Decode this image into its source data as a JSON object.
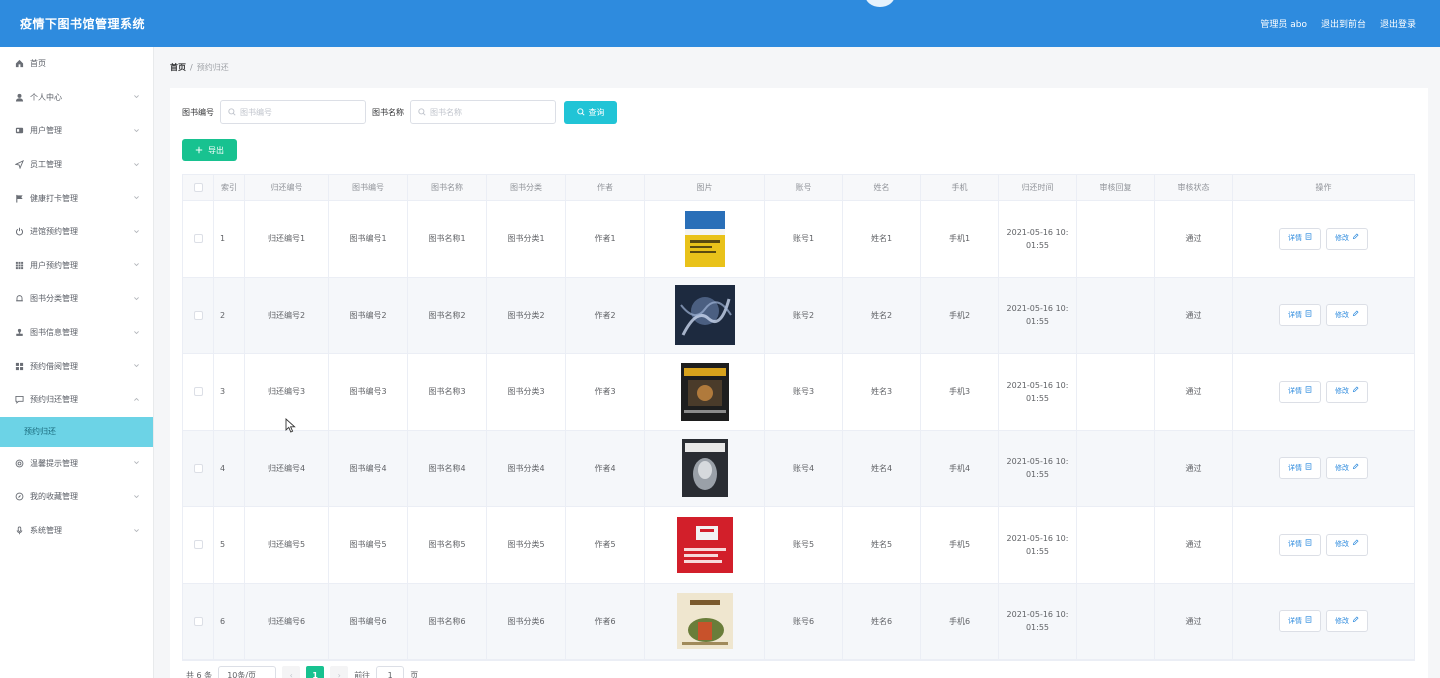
{
  "header": {
    "title": "疫情下图书馆管理系统",
    "user": "管理员 abo",
    "to_front": "退出到前台",
    "logout": "退出登录"
  },
  "sidebar": {
    "items": [
      {
        "label": "首页",
        "icon": "home-icon",
        "chevron": false
      },
      {
        "label": "个人中心",
        "icon": "user-icon",
        "chevron": true
      },
      {
        "label": "用户管理",
        "icon": "id-card-icon",
        "chevron": true
      },
      {
        "label": "员工管理",
        "icon": "send-icon",
        "chevron": true
      },
      {
        "label": "健康打卡管理",
        "icon": "flag-icon",
        "chevron": true
      },
      {
        "label": "进馆预约管理",
        "icon": "power-icon",
        "chevron": true
      },
      {
        "label": "用户预约管理",
        "icon": "grid-icon",
        "chevron": true
      },
      {
        "label": "图书分类管理",
        "icon": "bell-icon",
        "chevron": true
      },
      {
        "label": "图书信息管理",
        "icon": "stamp-icon",
        "chevron": true
      },
      {
        "label": "预约借阅管理",
        "icon": "apps-icon",
        "chevron": true
      },
      {
        "label": "预约归还管理",
        "icon": "message-icon",
        "chevron": true,
        "expanded": true
      }
    ],
    "active_sub": "预约归还",
    "items_after": [
      {
        "label": "温馨提示管理",
        "icon": "help-icon",
        "chevron": true
      },
      {
        "label": "我的收藏管理",
        "icon": "compass-icon",
        "chevron": true
      },
      {
        "label": "系统管理",
        "icon": "mic-icon",
        "chevron": true
      }
    ]
  },
  "breadcrumb": {
    "home": "首页",
    "sep": "/",
    "current": "预约归还"
  },
  "filters": {
    "book_no_label": "图书编号",
    "book_no_placeholder": "图书编号",
    "book_name_label": "图书名称",
    "book_name_placeholder": "图书名称",
    "query_label": "查询",
    "export_label": "导出"
  },
  "table": {
    "columns": [
      "",
      "索引",
      "归还编号",
      "图书编号",
      "图书名称",
      "图书分类",
      "作者",
      "图片",
      "账号",
      "姓名",
      "手机",
      "归还时间",
      "审核回复",
      "审核状态",
      "操作"
    ],
    "detail_label": "详情",
    "edit_label": "修改",
    "rows": [
      {
        "index": "1",
        "return_no": "归还编号1",
        "book_no": "图书编号1",
        "book_name": "图书名称1",
        "category": "图书分类1",
        "author": "作者1",
        "account": "账号1",
        "name": "姓名1",
        "phone": "手机1",
        "time": "2021-05-16 10:01:55",
        "reply": "",
        "status": "通过",
        "cover": "yellow"
      },
      {
        "index": "2",
        "return_no": "归还编号2",
        "book_no": "图书编号2",
        "book_name": "图书名称2",
        "category": "图书分类2",
        "author": "作者2",
        "account": "账号2",
        "name": "姓名2",
        "phone": "手机2",
        "time": "2021-05-16 10:01:55",
        "reply": "",
        "status": "通过",
        "cover": "dark-blue"
      },
      {
        "index": "3",
        "return_no": "归还编号3",
        "book_no": "图书编号3",
        "book_name": "图书名称3",
        "category": "图书分类3",
        "author": "作者3",
        "account": "账号3",
        "name": "姓名3",
        "phone": "手机3",
        "time": "2021-05-16 10:01:55",
        "reply": "",
        "status": "通过",
        "cover": "black"
      },
      {
        "index": "4",
        "return_no": "归还编号4",
        "book_no": "图书编号4",
        "book_name": "图书名称4",
        "category": "图书分类4",
        "author": "作者4",
        "account": "账号4",
        "name": "姓名4",
        "phone": "手机4",
        "time": "2021-05-16 10:01:55",
        "reply": "",
        "status": "通过",
        "cover": "grey"
      },
      {
        "index": "5",
        "return_no": "归还编号5",
        "book_no": "图书编号5",
        "book_name": "图书名称5",
        "category": "图书分类5",
        "author": "作者5",
        "account": "账号5",
        "name": "姓名5",
        "phone": "手机5",
        "time": "2021-05-16 10:01:55",
        "reply": "",
        "status": "通过",
        "cover": "red"
      },
      {
        "index": "6",
        "return_no": "归还编号6",
        "book_no": "图书编号6",
        "book_name": "图书名称6",
        "category": "图书分类6",
        "author": "作者6",
        "account": "账号6",
        "name": "姓名6",
        "phone": "手机6",
        "time": "2021-05-16 10:01:55",
        "reply": "",
        "status": "通过",
        "cover": "cream"
      }
    ]
  },
  "pagination": {
    "total": "共 6 条",
    "page_size": "10条/页",
    "current_page": "1",
    "goto_label": "前往",
    "goto_value": "1",
    "page_suffix": "页"
  },
  "colors": {
    "header": "#2e8bde",
    "active_menu": "#6cd3e6",
    "query_button": "#21c4d6",
    "export_button": "#18c290",
    "link": "#2e8bde"
  }
}
